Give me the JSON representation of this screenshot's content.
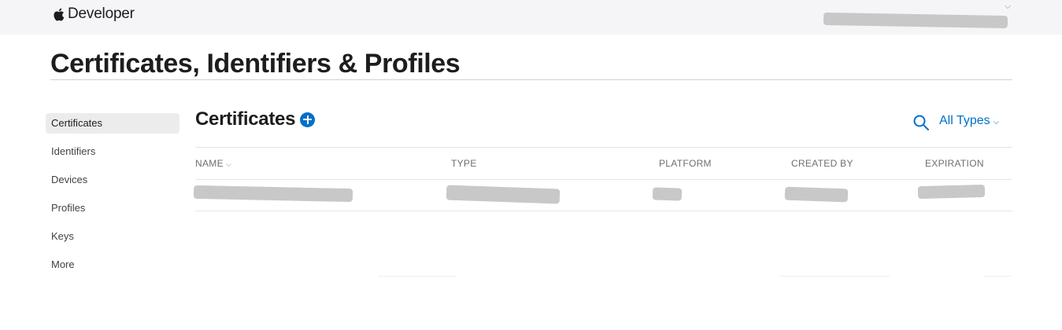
{
  "header": {
    "brand": "Developer",
    "account_name": "",
    "account_chevron": "⌵"
  },
  "page": {
    "title": "Certificates, Identifiers & Profiles"
  },
  "sidebar": {
    "items": [
      {
        "label": "Certificates",
        "active": true
      },
      {
        "label": "Identifiers"
      },
      {
        "label": "Devices"
      },
      {
        "label": "Profiles"
      },
      {
        "label": "Keys"
      },
      {
        "label": "More"
      }
    ]
  },
  "main": {
    "title": "Certificates",
    "add_icon": "plus-circle-icon",
    "search_icon": "search-icon",
    "filter_label": "All Types",
    "filter_chevron": "⌵",
    "sort_chevron": "⌵",
    "columns": [
      "NAME",
      "TYPE",
      "PLATFORM",
      "CREATED BY",
      "EXPIRATION"
    ]
  },
  "colors": {
    "accent": "#0070c9",
    "topbar": "#f5f5f7",
    "sidebar_active": "#ececec",
    "redaction": "#c8c8c8"
  }
}
